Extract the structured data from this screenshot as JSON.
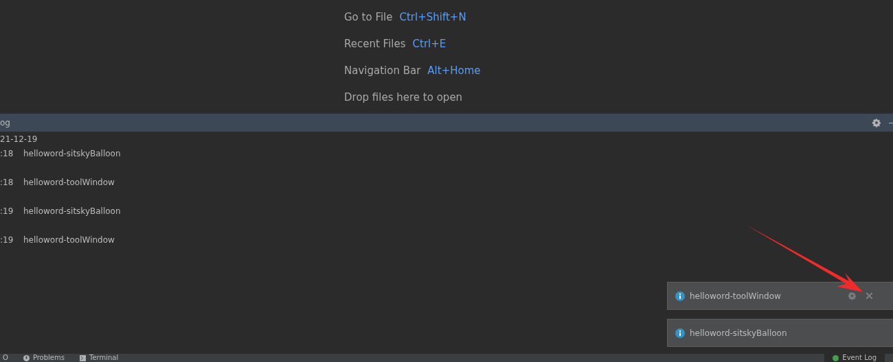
{
  "welcome_hints": [
    {
      "label": "Go to File",
      "shortcut": "Ctrl+Shift+N"
    },
    {
      "label": "Recent Files",
      "shortcut": "Ctrl+E"
    },
    {
      "label": "Navigation Bar",
      "shortcut": "Alt+Home"
    },
    {
      "label": "Drop files here to open"
    }
  ],
  "event_log": {
    "title": "og",
    "date": "21-12-19",
    "entries": [
      {
        "time": ":18",
        "message": "helloword-sitskyBalloon"
      },
      {
        "time": ":18",
        "message": "helloword-toolWindow"
      },
      {
        "time": ":19",
        "message": "helloword-sitskyBalloon"
      },
      {
        "time": ":19",
        "message": "helloword-toolWindow"
      }
    ]
  },
  "notifications": [
    {
      "message": "helloword-toolWindow",
      "actions": true
    },
    {
      "message": "helloword-sitskyBalloon",
      "actions": false
    }
  ],
  "status_bar": {
    "tabs": [
      {
        "label": "O",
        "kind": "plain",
        "selected": false
      },
      {
        "label": "Problems",
        "kind": "problems",
        "selected": false
      },
      {
        "label": "Terminal",
        "kind": "terminal",
        "selected": false
      }
    ],
    "right_tabs": [
      {
        "label": "Event Log",
        "kind": "eventlog",
        "selected": true
      }
    ]
  }
}
